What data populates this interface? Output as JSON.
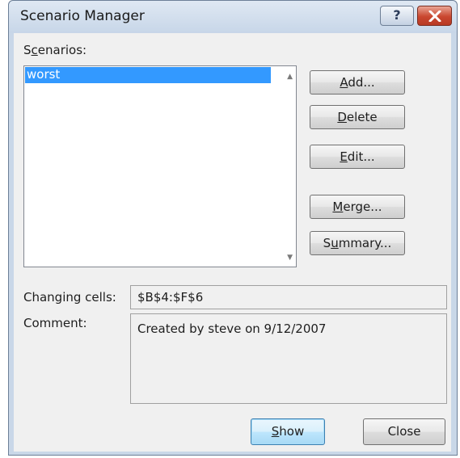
{
  "window": {
    "title": "Scenario Manager",
    "help_label": "?"
  },
  "scenarios": {
    "label_pre": "S",
    "label_ul": "c",
    "label_post": "enarios:",
    "items": [
      "worst"
    ],
    "selected_index": 0
  },
  "buttons": {
    "add": {
      "ul": "A",
      "rest": "dd..."
    },
    "delete": {
      "ul": "D",
      "rest": "elete"
    },
    "edit": {
      "ul": "E",
      "rest": "dit..."
    },
    "merge": {
      "ul": "M",
      "rest": "erge..."
    },
    "summary": {
      "pre": "S",
      "ul": "u",
      "rest": "mmary..."
    },
    "show": {
      "ul": "S",
      "rest": "how"
    },
    "close": "Close"
  },
  "details": {
    "changing_cells_label": "Changing cells:",
    "changing_cells_value": "$B$4:$F$6",
    "comment_label": "Comment:",
    "comment_value": "Created by steve on 9/12/2007"
  },
  "colors": {
    "selection": "#3399ff",
    "title_bar": "#c9d7e8",
    "close_button": "#c9462f",
    "dialog_background": "#f0f0f0"
  },
  "icons": {
    "help": "question-mark-icon",
    "close": "x-close-icon",
    "scroll_up": "scroll-up-arrow-icon",
    "scroll_down": "scroll-down-arrow-icon"
  }
}
